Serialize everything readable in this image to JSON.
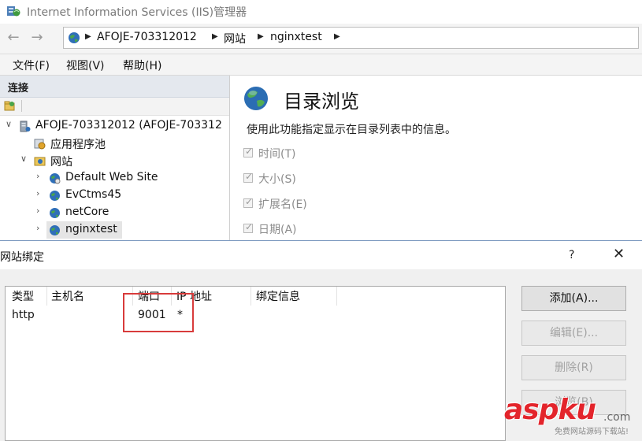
{
  "window": {
    "title": "Internet Information Services (IIS)管理器"
  },
  "nav": {
    "back_icon": "back-arrow-icon",
    "forward_icon": "forward-arrow-icon",
    "breadcrumb": [
      "AFOJE-703312012",
      "网站",
      "nginxtest"
    ]
  },
  "menu": [
    "文件(F)",
    "视图(V)",
    "帮助(H)"
  ],
  "connections": {
    "title": "连接",
    "tree": {
      "server": "AFOJE-703312012 (AFOJE-703312",
      "app_pools": "应用程序池",
      "sites": "网站",
      "site_items": [
        "Default Web Site",
        "EvCtms45",
        "netCore",
        "nginxtest"
      ],
      "selected": "nginxtest"
    }
  },
  "feature": {
    "title": "目录浏览",
    "description": "使用此功能指定显示在目录列表中的信息。",
    "options": [
      {
        "label": "时间(T)",
        "checked": true
      },
      {
        "label": "大小(S)",
        "checked": true
      },
      {
        "label": "扩展名(E)",
        "checked": true
      },
      {
        "label": "日期(A)",
        "checked": true
      }
    ]
  },
  "dialog": {
    "title": "网站绑定",
    "help": "?",
    "close": "✕",
    "columns": [
      "类型",
      "主机名",
      "端口",
      "IP 地址",
      "绑定信息"
    ],
    "rows": [
      {
        "type": "http",
        "host": "",
        "port": "9001",
        "ip": "*",
        "info": ""
      }
    ],
    "buttons": [
      {
        "label": "添加(A)...",
        "enabled": true
      },
      {
        "label": "编辑(E)...",
        "enabled": false
      },
      {
        "label": "删除(R)",
        "enabled": false
      },
      {
        "label": "浏览(B)",
        "enabled": false
      }
    ]
  },
  "watermark": {
    "logo": "aspku",
    "suffix": ".com",
    "tagline": "免费网站源码下载站!"
  },
  "colors": {
    "highlight": "#d83b3b",
    "watermark_red": "#e3242b"
  }
}
